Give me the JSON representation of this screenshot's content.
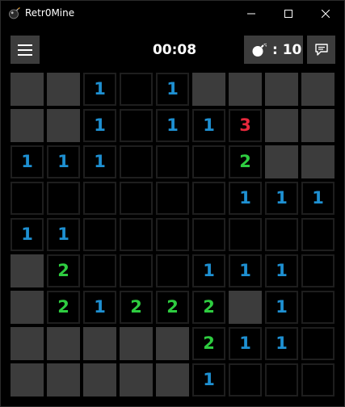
{
  "window": {
    "title": "Retr0Mine"
  },
  "toolbar": {
    "timer": "00:08",
    "mine_count": ": 10"
  },
  "colors": {
    "closed_tile": "#3c3c3c",
    "num_1": "#1e90d2",
    "num_2": "#2ecc40",
    "num_3": "#e8283c"
  },
  "board": {
    "rows": [
      [
        "C",
        "C",
        "1",
        "",
        "1",
        "C",
        "C",
        "C",
        "C"
      ],
      [
        "C",
        "C",
        "1",
        "",
        "1",
        "1",
        "3",
        "C",
        "C"
      ],
      [
        "1",
        "1",
        "1",
        "",
        "",
        "",
        "2",
        "C",
        "C"
      ],
      [
        "",
        "",
        "",
        "",
        "",
        "",
        "1",
        "1",
        "1"
      ],
      [
        "1",
        "1",
        "",
        "",
        "",
        "",
        "",
        "",
        ""
      ],
      [
        "C",
        "2",
        "",
        "",
        "",
        "1",
        "1",
        "1",
        ""
      ],
      [
        "C",
        "2",
        "1",
        "2",
        "2",
        "2",
        "C",
        "1",
        ""
      ],
      [
        "C",
        "C",
        "C",
        "C",
        "C",
        "2",
        "1",
        "1",
        ""
      ],
      [
        "C",
        "C",
        "C",
        "C",
        "C",
        "1",
        "",
        "",
        ""
      ]
    ]
  }
}
